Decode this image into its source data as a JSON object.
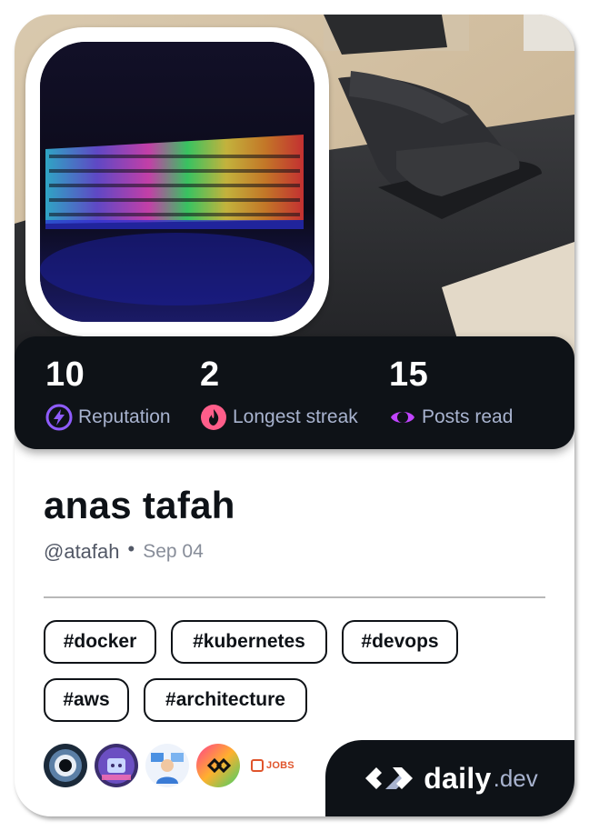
{
  "stats": [
    {
      "value": "10",
      "label": "Reputation",
      "icon": "reputation-bolt-icon",
      "color": "#8f5cff"
    },
    {
      "value": "2",
      "label": "Longest streak",
      "icon": "streak-flame-icon",
      "color": "#ff5e8a"
    },
    {
      "value": "15",
      "label": "Posts read",
      "icon": "posts-read-eye-icon",
      "color": "#c144ff"
    }
  ],
  "profile": {
    "name": "anas tafah",
    "handle": "@atafah",
    "separator": "•",
    "date": "Sep 04"
  },
  "tags": [
    "#docker",
    "#kubernetes",
    "#devops",
    "#aws",
    "#architecture"
  ],
  "sources": [
    "source-avatar-1",
    "source-avatar-2",
    "source-avatar-3",
    "source-avatar-4"
  ],
  "jobs_label": "JOBS",
  "brand": {
    "main": "daily",
    "sub": ".dev"
  },
  "colors": {
    "panel": "#0e1217",
    "muted": "#a8b3cf",
    "text": "#0e1217"
  }
}
